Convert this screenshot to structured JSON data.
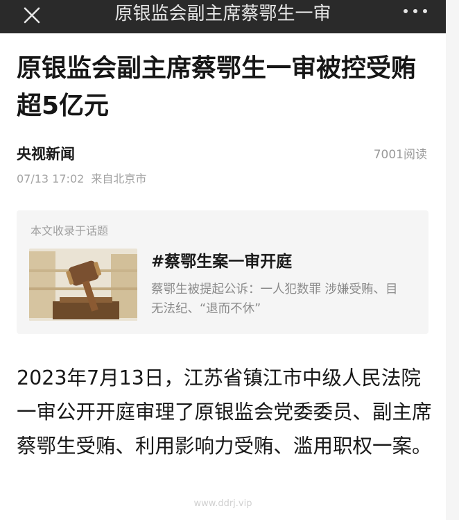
{
  "nav": {
    "title": "原银监会副主席蔡鄂生一审",
    "close_icon": "close-icon",
    "more_icon": "more-dots-icon",
    "background": "#2a2a2a"
  },
  "article": {
    "headline": "原银监会副主席蔡鄂生一审被控受贿超5亿元",
    "source": "央视新闻",
    "reads": "7001阅读",
    "datetime": "07/13 17:02",
    "location": "来自北京市"
  },
  "topic": {
    "caption": "本文收录于话题",
    "title": "#蔡鄂生案一审开庭",
    "description": "蔡鄂生被提起公诉：一人犯数罪 涉嫌受贿、目无法纪、“退而不休”",
    "thumbnail_icon": "gavel-icon"
  },
  "body": {
    "paragraph": "2023年7月13日，江苏省镇江市中级人民法院一审公开开庭审理了原银监会党委委员、副主席蔡鄂生受贿、利用影响力受贿、滥用职权一案。"
  },
  "watermark": "www.ddrj.vip"
}
